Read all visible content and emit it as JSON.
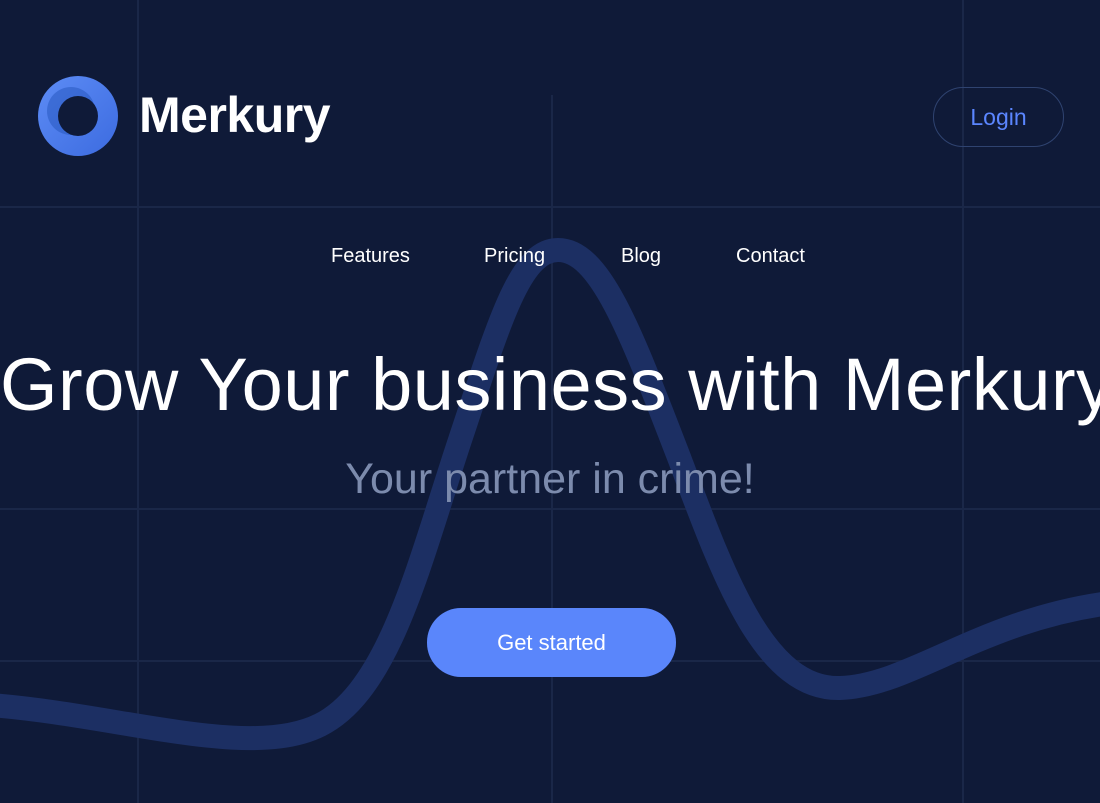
{
  "header": {
    "brand_name": "Merkury",
    "logo_icon": "ring-logo-icon",
    "login_label": "Login"
  },
  "nav": {
    "items": [
      {
        "label": "Features"
      },
      {
        "label": "Pricing"
      },
      {
        "label": "Blog"
      },
      {
        "label": "Contact"
      }
    ]
  },
  "hero": {
    "title": "Grow Your business with Merkury",
    "subtitle": "Your partner in crime!",
    "cta_label": "Get started"
  },
  "colors": {
    "background": "#0f1a38",
    "accent": "#5a86fb",
    "login_text": "#5b86ff",
    "subtitle_text": "#7c8bad"
  }
}
